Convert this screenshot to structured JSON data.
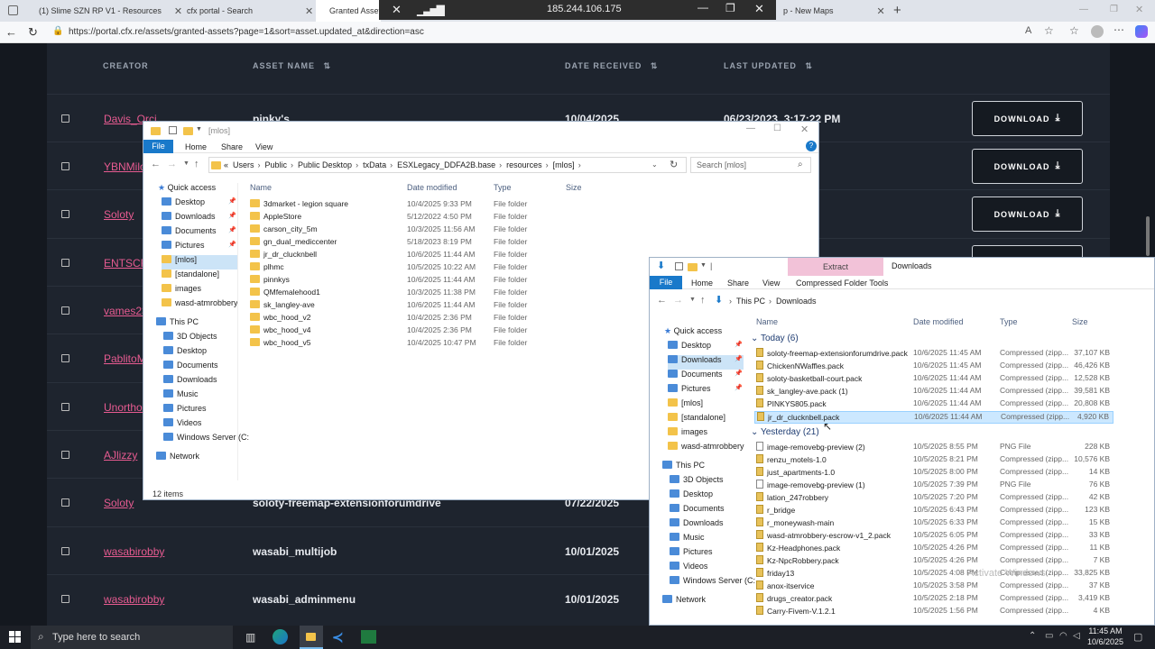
{
  "browser": {
    "tabs": [
      {
        "label": "(1) Slime SZN RP V1 - Resources",
        "color": "#3ab0c9"
      },
      {
        "label": "cfx portal - Search",
        "color": "#4285f4"
      },
      {
        "label": "Granted Asset",
        "color": "#111111"
      },
      {
        "label": "p - New Maps",
        "color": "#888888"
      }
    ],
    "remote_ip": "185.244.106.175",
    "url": "https://portal.cfx.re/assets/granted-assets?page=1&sort=asset.updated_at&direction=asc"
  },
  "table": {
    "headers": {
      "creator": "CREATOR",
      "asset_name": "ASSET NAME",
      "date_received": "DATE RECEIVED",
      "last_updated": "LAST UPDATED"
    },
    "download_label": "DOWNLOAD",
    "rows": [
      {
        "creator": "Davis_Orci",
        "asset": "pinky's",
        "date": "10/04/2025",
        "updated": "06/23/2023, 3:17:22 PM",
        "download": true
      },
      {
        "creator": "YBNMilos",
        "asset": "",
        "date": "",
        "updated": "AM",
        "download": true
      },
      {
        "creator": "Soloty",
        "asset": "",
        "date": "",
        "updated": "PM",
        "download": true
      },
      {
        "creator": "ENTSCR",
        "asset": "",
        "date": "",
        "updated": "",
        "download": false
      },
      {
        "creator": "vames23",
        "asset": "",
        "date": "",
        "updated": "",
        "download": false
      },
      {
        "creator": "PablitoM",
        "asset": "",
        "date": "",
        "updated": "",
        "download": false
      },
      {
        "creator": "Unorthod",
        "asset": "",
        "date": "",
        "updated": "",
        "download": false
      },
      {
        "creator": "AJlizzy",
        "asset": "",
        "date": "",
        "updated": "",
        "download": false
      },
      {
        "creator": "Soloty",
        "asset": "soloty-freemap-extensionforumdrive",
        "date": "07/22/2025",
        "updated": "",
        "download": false
      },
      {
        "creator": "wasabirobby",
        "asset": "wasabi_multijob",
        "date": "10/01/2025",
        "updated": "",
        "download": false
      },
      {
        "creator": "wasabirobby",
        "asset": "wasabi_adminmenu",
        "date": "10/01/2025",
        "updated": "",
        "download": false
      }
    ]
  },
  "explorer1": {
    "title": "[mlos]",
    "ribbon": [
      "File",
      "Home",
      "Share",
      "View"
    ],
    "path": [
      "Users",
      "Public",
      "Public Desktop",
      "txData",
      "ESXLegacy_DDFA2B.base",
      "resources",
      "[mlos]"
    ],
    "search_placeholder": "Search [mlos]",
    "columns": [
      "Name",
      "Date modified",
      "Type",
      "Size"
    ],
    "nav": {
      "quick_access": "Quick access",
      "qa_items": [
        "Desktop",
        "Downloads",
        "Documents",
        "Pictures",
        "[mlos]",
        "[standalone]",
        "images",
        "wasd-atmrobbery"
      ],
      "this_pc": "This PC",
      "pc_items": [
        "3D Objects",
        "Desktop",
        "Documents",
        "Downloads",
        "Music",
        "Pictures",
        "Videos",
        "Windows Server (C:"
      ],
      "network": "Network"
    },
    "files": [
      {
        "name": "3dmarket - legion square",
        "date": "10/4/2025 9:33 PM",
        "type": "File folder"
      },
      {
        "name": "AppleStore",
        "date": "5/12/2022 4:50 PM",
        "type": "File folder"
      },
      {
        "name": "carson_city_5m",
        "date": "10/3/2025 11:56 AM",
        "type": "File folder"
      },
      {
        "name": "gn_dual_mediccenter",
        "date": "5/18/2023 8:19 PM",
        "type": "File folder"
      },
      {
        "name": "jr_dr_clucknbell",
        "date": "10/6/2025 11:44 AM",
        "type": "File folder"
      },
      {
        "name": "plhmc",
        "date": "10/5/2025 10:22 AM",
        "type": "File folder"
      },
      {
        "name": "pinnkys",
        "date": "10/6/2025 11:44 AM",
        "type": "File folder"
      },
      {
        "name": "QMfemalehood1",
        "date": "10/3/2025 11:38 PM",
        "type": "File folder"
      },
      {
        "name": "sk_langley-ave",
        "date": "10/6/2025 11:44 AM",
        "type": "File folder"
      },
      {
        "name": "wbc_hood_v2",
        "date": "10/4/2025 2:36 PM",
        "type": "File folder"
      },
      {
        "name": "wbc_hood_v4",
        "date": "10/4/2025 2:36 PM",
        "type": "File folder"
      },
      {
        "name": "wbc_hood_v5",
        "date": "10/4/2025 10:47 PM",
        "type": "File folder"
      }
    ],
    "status": "12 items"
  },
  "explorer2": {
    "title": "Downloads",
    "extract": "Extract",
    "ribbon": [
      "File",
      "Home",
      "Share",
      "View"
    ],
    "ribbon_tool": "Compressed Folder Tools",
    "path": [
      "This PC",
      "Downloads"
    ],
    "columns": [
      "Name",
      "Date modified",
      "Type",
      "Size"
    ],
    "nav": {
      "quick_access": "Quick access",
      "qa_items": [
        "Desktop",
        "Downloads",
        "Documents",
        "Pictures",
        "[mlos]",
        "[standalone]",
        "images",
        "wasd-atmrobbery"
      ],
      "this_pc": "This PC",
      "pc_items": [
        "3D Objects",
        "Desktop",
        "Documents",
        "Downloads",
        "Music",
        "Pictures",
        "Videos",
        "Windows Server (C:"
      ],
      "network": "Network"
    },
    "groups": [
      {
        "label": "Today (6)",
        "files": [
          {
            "name": "soloty-freemap-extensionforumdrive.pack",
            "date": "10/6/2025 11:45 AM",
            "type": "Compressed (zipp...",
            "size": "37,107 KB",
            "icon": "zip"
          },
          {
            "name": "ChickenNWaffles.pack",
            "date": "10/6/2025 11:45 AM",
            "type": "Compressed (zipp...",
            "size": "46,426 KB",
            "icon": "zip"
          },
          {
            "name": "soloty-basketball-court.pack",
            "date": "10/6/2025 11:44 AM",
            "type": "Compressed (zipp...",
            "size": "12,528 KB",
            "icon": "zip"
          },
          {
            "name": "sk_langley-ave.pack (1)",
            "date": "10/6/2025 11:44 AM",
            "type": "Compressed (zipp...",
            "size": "39,581 KB",
            "icon": "zip"
          },
          {
            "name": "PINKYS805.pack",
            "date": "10/6/2025 11:44 AM",
            "type": "Compressed (zipp...",
            "size": "20,808 KB",
            "icon": "zip"
          },
          {
            "name": "jr_dr_clucknbell.pack",
            "date": "10/6/2025 11:44 AM",
            "type": "Compressed (zipp...",
            "size": "4,920 KB",
            "icon": "zip",
            "selected": true
          }
        ]
      },
      {
        "label": "Yesterday (21)",
        "files": [
          {
            "name": "image-removebg-preview (2)",
            "date": "10/5/2025 8:55 PM",
            "type": "PNG File",
            "size": "228 KB",
            "icon": "png"
          },
          {
            "name": "renzu_motels-1.0",
            "date": "10/5/2025 8:21 PM",
            "type": "Compressed (zipp...",
            "size": "10,576 KB",
            "icon": "zip"
          },
          {
            "name": "just_apartments-1.0",
            "date": "10/5/2025 8:00 PM",
            "type": "Compressed (zipp...",
            "size": "14 KB",
            "icon": "zip"
          },
          {
            "name": "image-removebg-preview (1)",
            "date": "10/5/2025 7:39 PM",
            "type": "PNG File",
            "size": "76 KB",
            "icon": "png"
          },
          {
            "name": "lation_247robbery",
            "date": "10/5/2025 7:20 PM",
            "type": "Compressed (zipp...",
            "size": "42 KB",
            "icon": "zip"
          },
          {
            "name": "r_bridge",
            "date": "10/5/2025 6:43 PM",
            "type": "Compressed (zipp...",
            "size": "123 KB",
            "icon": "zip"
          },
          {
            "name": "r_moneywash-main",
            "date": "10/5/2025 6:33 PM",
            "type": "Compressed (zipp...",
            "size": "15 KB",
            "icon": "zip"
          },
          {
            "name": "wasd-atmrobbery-escrow-v1_2.pack",
            "date": "10/5/2025 6:05 PM",
            "type": "Compressed (zipp...",
            "size": "33 KB",
            "icon": "zip"
          },
          {
            "name": "Kz-Headphones.pack",
            "date": "10/5/2025 4:26 PM",
            "type": "Compressed (zipp...",
            "size": "11 KB",
            "icon": "zip"
          },
          {
            "name": "Kz-NpcRobbery.pack",
            "date": "10/5/2025 4:26 PM",
            "type": "Compressed (zipp...",
            "size": "7 KB",
            "icon": "zip"
          },
          {
            "name": "friday13",
            "date": "10/5/2025 4:08 PM",
            "type": "Compressed (zipp...",
            "size": "33,825 KB",
            "icon": "zip"
          },
          {
            "name": "anox-itservice",
            "date": "10/5/2025 3:58 PM",
            "type": "Compressed (zipp...",
            "size": "37 KB",
            "icon": "zip"
          },
          {
            "name": "drugs_creator.pack",
            "date": "10/5/2025 2:18 PM",
            "type": "Compressed (zipp...",
            "size": "3,419 KB",
            "icon": "zip"
          },
          {
            "name": "Carry-Fivem-V.1.2.1",
            "date": "10/5/2025 1:56 PM",
            "type": "Compressed (zipp...",
            "size": "4 KB",
            "icon": "zip"
          }
        ]
      }
    ],
    "watermark": "Activate Windows"
  },
  "taskbar": {
    "search_placeholder": "Type here to search",
    "time": "11:45 AM",
    "date": "10/6/2025"
  }
}
